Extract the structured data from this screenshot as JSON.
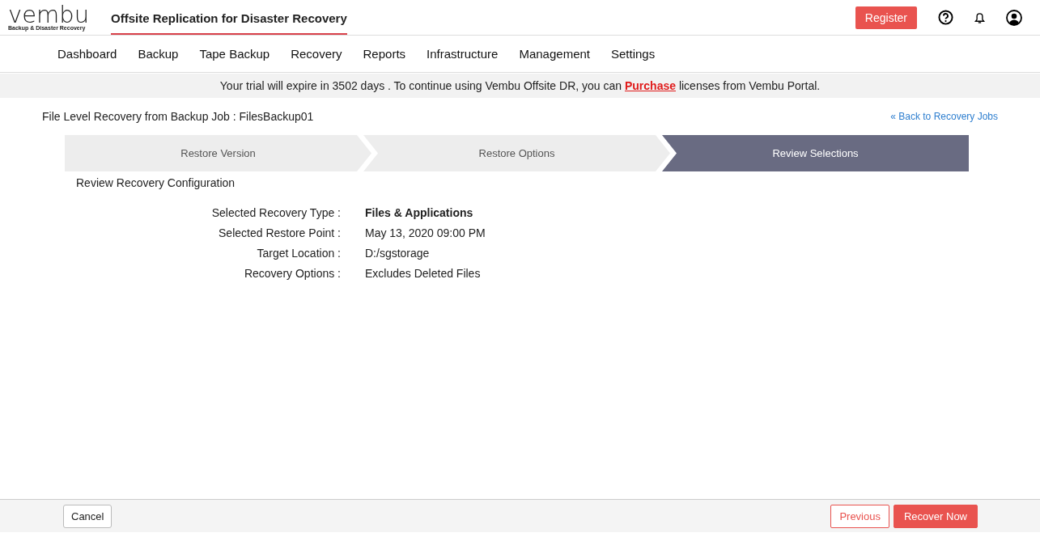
{
  "header": {
    "logo": "vembu",
    "logo_tagline": "Backup & Disaster Recovery",
    "product_title": "Offsite Replication for Disaster Recovery",
    "register": "Register"
  },
  "nav": [
    {
      "label": "Dashboard"
    },
    {
      "label": "Backup"
    },
    {
      "label": "Tape Backup"
    },
    {
      "label": "Recovery"
    },
    {
      "label": "Reports"
    },
    {
      "label": "Infrastructure"
    },
    {
      "label": "Management"
    },
    {
      "label": "Settings"
    }
  ],
  "banner": {
    "before": "Your trial will expire in 3502 days . To continue using Vembu Offsite DR, you can ",
    "link": "Purchase",
    "after": " licenses from Vembu Portal."
  },
  "page_title": "File Level Recovery from Backup Job : FilesBackup01",
  "back_link": "« Back to Recovery Jobs",
  "steps": [
    {
      "label": "Restore Version",
      "selected": false
    },
    {
      "label": "Restore Options",
      "selected": false
    },
    {
      "label": "Review Selections",
      "selected": true
    }
  ],
  "section_title": "Review Recovery Configuration",
  "summary": [
    {
      "label": "Selected Recovery Type :",
      "value": "Files & Applications",
      "emphasis": true
    },
    {
      "label": "Selected Restore Point :",
      "value": "May 13, 2020 09:00 PM",
      "emphasis": false
    },
    {
      "label": "Target Location :",
      "value": "D:/sgstorage",
      "emphasis": false
    },
    {
      "label": "Recovery Options :",
      "value": "Excludes Deleted Files",
      "emphasis": false
    }
  ],
  "footer": {
    "cancel": "Cancel",
    "previous": "Previous",
    "recover": "Recover Now"
  }
}
